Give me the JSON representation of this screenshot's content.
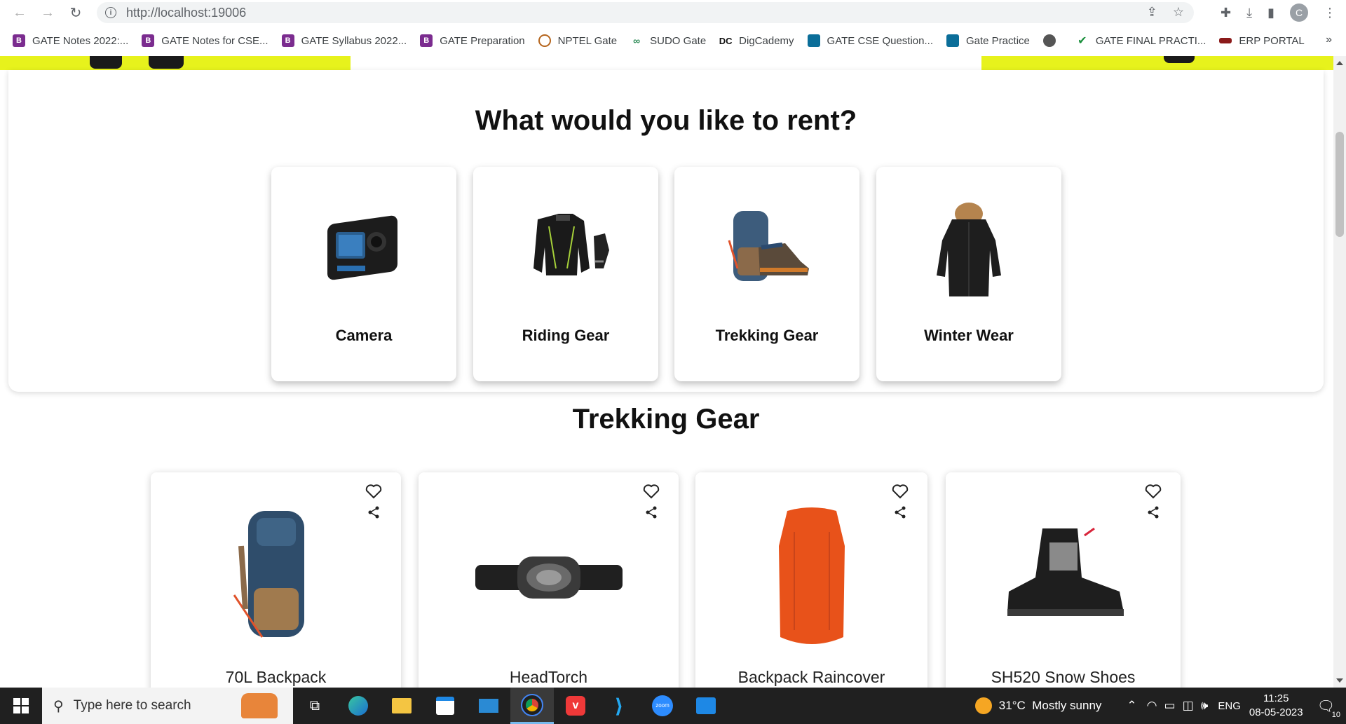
{
  "browser": {
    "url": "http://localhost:19006",
    "profile_initial": "C",
    "bookmarks": [
      {
        "label": "GATE Notes 2022:...",
        "icon": "purple-b-icon",
        "color": "#7b2c8f"
      },
      {
        "label": "GATE Notes for CSE...",
        "icon": "purple-b-icon",
        "color": "#7b2c8f"
      },
      {
        "label": "GATE Syllabus 2022...",
        "icon": "purple-b-icon",
        "color": "#7b2c8f"
      },
      {
        "label": "GATE Preparation",
        "icon": "purple-b-icon",
        "color": "#7b2c8f"
      },
      {
        "label": "NPTEL Gate",
        "icon": "nptel-icon",
        "color": "#b5651d"
      },
      {
        "label": "SUDO Gate",
        "icon": "sudo-icon",
        "color": "#2e8b57"
      },
      {
        "label": "DigCademy",
        "icon": "dc-icon",
        "color": "#111111"
      },
      {
        "label": "GATE CSE Question...",
        "icon": "book-icon",
        "color": "#0b6e99"
      },
      {
        "label": "Gate Practice",
        "icon": "book-icon",
        "color": "#0b6e99"
      },
      {
        "label": "",
        "icon": "globe-icon",
        "color": "#555555"
      },
      {
        "label": "GATE FINAL PRACTI...",
        "icon": "check-icon",
        "color": "#1a8f3c"
      },
      {
        "label": "ERP PORTAL",
        "icon": "erp-icon",
        "color": "#8b1a1a"
      }
    ],
    "more": "»"
  },
  "rent": {
    "title": "What would you like to rent?",
    "categories": [
      {
        "label": "Camera"
      },
      {
        "label": "Riding Gear"
      },
      {
        "label": "Trekking Gear"
      },
      {
        "label": "Winter Wear"
      }
    ]
  },
  "section": {
    "title": "Trekking Gear",
    "products": [
      {
        "name": "70L Backpack"
      },
      {
        "name": "HeadTorch"
      },
      {
        "name": "Backpack Raincover"
      },
      {
        "name": "SH520 Snow Shoes"
      }
    ]
  },
  "colors": {
    "accent_yellow": "#e7f21c",
    "raincover_orange": "#e8521a"
  },
  "taskbar": {
    "search_placeholder": "Type here to search",
    "weather": "31°C  Mostly sunny",
    "lang": "ENG",
    "time": "11:25",
    "date": "08-05-2023",
    "notifications": "10"
  }
}
